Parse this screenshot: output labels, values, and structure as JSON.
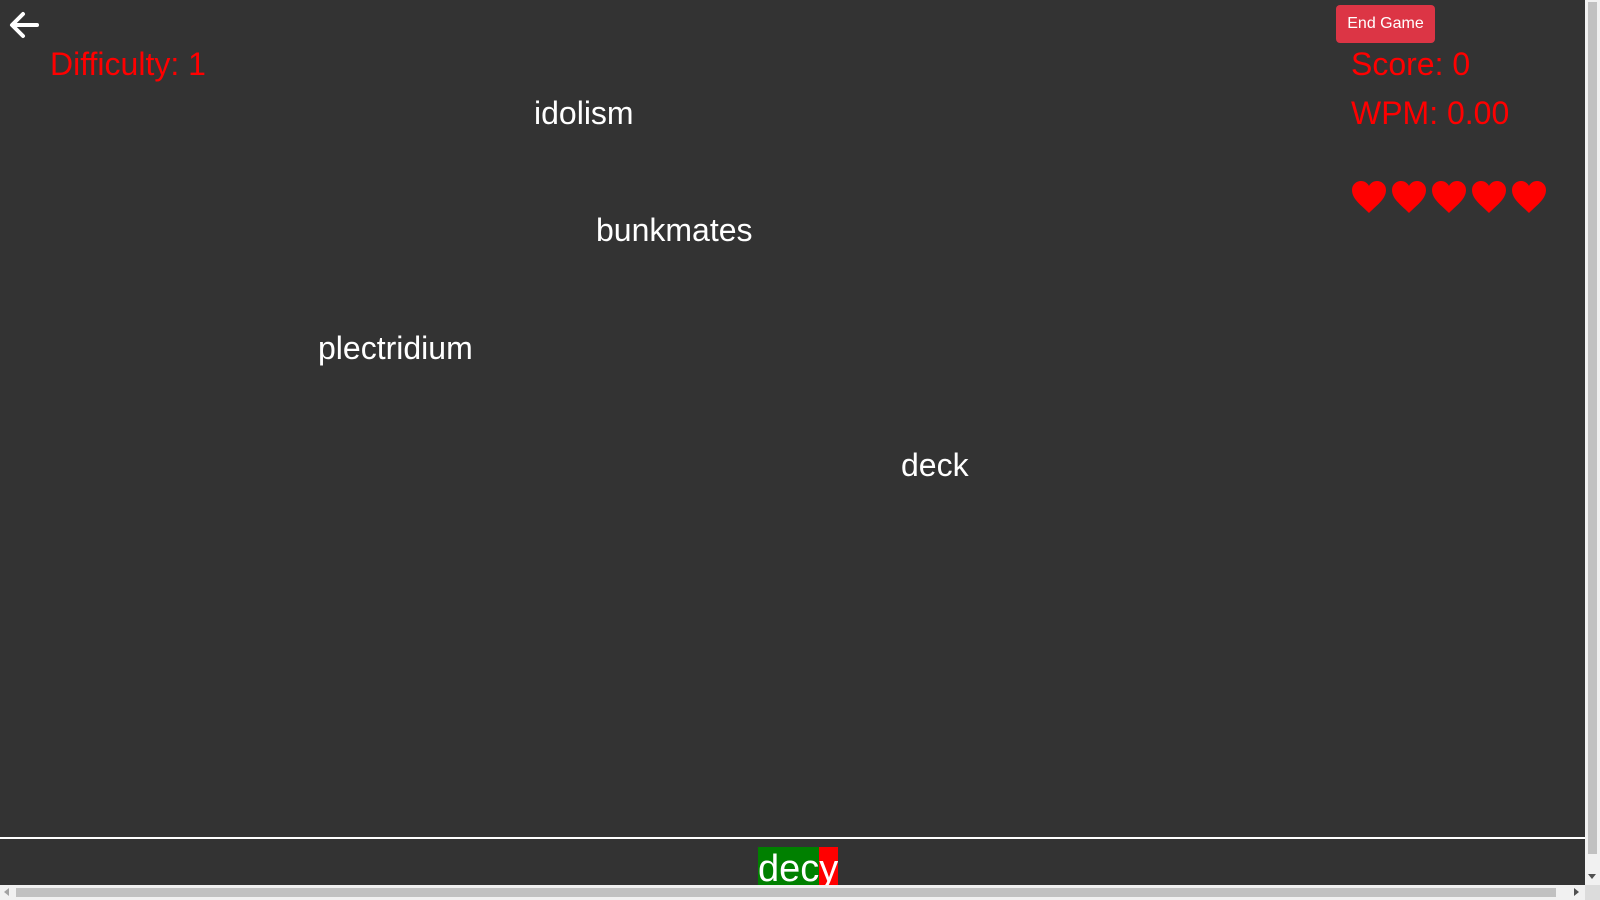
{
  "header": {
    "difficulty": "Difficulty: 1",
    "end_game_label": "End Game",
    "score": "Score: 0",
    "wpm": "WPM: 0.00"
  },
  "lives": {
    "remaining": 5,
    "icon": "heart-icon",
    "color": "#ff0000"
  },
  "falling_words": [
    {
      "text": "idolism"
    },
    {
      "text": "bunkmates"
    },
    {
      "text": "plectridium"
    },
    {
      "text": "deck"
    }
  ],
  "input": {
    "correct_part": "dec",
    "wrong_part": "y",
    "correct_color": "#008000",
    "wrong_color": "#ff0000"
  },
  "colors": {
    "background": "#333333",
    "status_text": "#ff0000",
    "end_button": "#dc3545",
    "word_text": "#ffffff"
  },
  "icons": {
    "back": "arrow-left-icon"
  }
}
